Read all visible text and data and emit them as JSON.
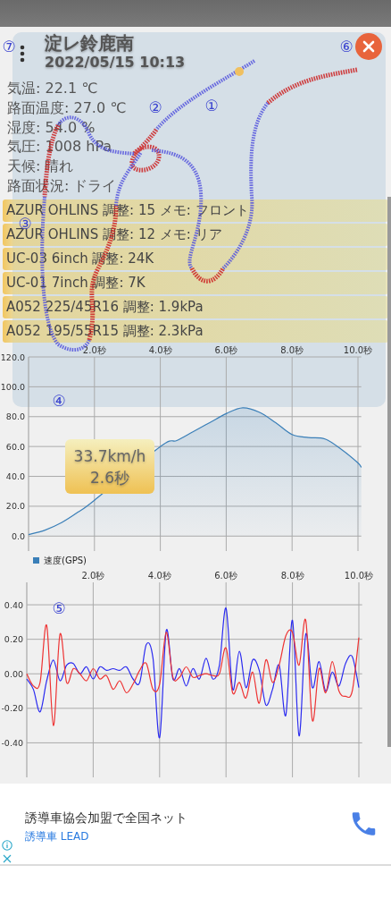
{
  "header": {
    "title": "淀レ鈴鹿南",
    "datetime": "2022/05/15 10:13"
  },
  "conditions": [
    "気温: 22.1 ℃",
    "路面温度: 27.0 ℃",
    "湿度: 54.0 %",
    "気圧: 1008 hPa",
    "天候: 晴れ",
    "路面状況: ドライ"
  ],
  "setups": [
    "AZUR OHLINS 調整: 15 メモ: フロント",
    "AZUR OHLINS 調整: 12 メモ: リア",
    "UC-03 6inch 調整: 24K",
    "UC-01 7inch 調整: 7K",
    "A052 225/45R16 調整: 1.9kPa",
    "A052 195/55R15 調整: 2.3kPa"
  ],
  "speed_chart": {
    "tooltip": {
      "value": "33.7km/h",
      "time": "2.6秒"
    },
    "chart_data": {
      "type": "area",
      "grid": true,
      "x": [
        0,
        0.5,
        1,
        1.5,
        2,
        4,
        4.5,
        5,
        5.5,
        6,
        6.5,
        7,
        7.5,
        8,
        8.5,
        9,
        9.5,
        10,
        10.1
      ],
      "series": [
        {
          "name": "速度(GPS)",
          "color": "#3a7fb8",
          "values": [
            1,
            4,
            9,
            16,
            24,
            60,
            64,
            70,
            76,
            82,
            86,
            83,
            76,
            68,
            66,
            65,
            58,
            49,
            46
          ]
        }
      ],
      "xlim": [
        0,
        10.1
      ],
      "ylim": [
        -10,
        120
      ],
      "xticks": [
        {
          "value": 2,
          "label": "2.0秒"
        },
        {
          "value": 4,
          "label": "4.0秒"
        },
        {
          "value": 6,
          "label": "6.0秒"
        },
        {
          "value": 8,
          "label": "8.0秒"
        },
        {
          "value": 10,
          "label": "10.0秒"
        }
      ],
      "yticks": [
        {
          "value": 0,
          "label": "0.0"
        },
        {
          "value": 20,
          "label": "20.0"
        },
        {
          "value": 40,
          "label": "40.0"
        },
        {
          "value": 60,
          "label": "60.0"
        },
        {
          "value": 80,
          "label": "80.0"
        },
        {
          "value": 100,
          "label": "100.0"
        },
        {
          "value": 120,
          "label": "120.0"
        }
      ]
    }
  },
  "g_chart": {
    "chart_data": {
      "type": "line",
      "grid": true,
      "x": [
        0,
        0.2,
        0.4,
        0.6,
        0.8,
        1,
        1.2,
        1.4,
        1.6,
        1.8,
        2,
        2.2,
        2.4,
        2.6,
        2.8,
        3,
        3.2,
        3.4,
        3.6,
        3.8,
        4,
        4.2,
        4.4,
        4.6,
        4.8,
        5,
        5.2,
        5.4,
        5.6,
        5.8,
        6,
        6.2,
        6.4,
        6.6,
        6.8,
        7,
        7.2,
        7.4,
        7.6,
        7.8,
        8,
        8.2,
        8.4,
        8.6,
        8.8,
        9,
        9.2,
        9.4,
        9.6,
        9.8,
        10
      ],
      "series": [
        {
          "color": "#2a2af0",
          "values": [
            -0.03,
            -0.09,
            -0.22,
            -0.04,
            0.08,
            -0.04,
            0.05,
            0.06,
            0,
            0.04,
            -0.03,
            0.04,
            0.02,
            0.03,
            0.02,
            0.04,
            -0.03,
            -0.05,
            0.17,
            0.09,
            -0.37,
            0.25,
            -0.03,
            0.03,
            -0.07,
            0.03,
            -0.03,
            0.09,
            -0.03,
            0.05,
            0.38,
            -0.09,
            0.13,
            -0.08,
            0.08,
            0.02,
            -0.18,
            -0.09,
            0.05,
            -0.24,
            0.31,
            -0.36,
            0.23,
            -0.08,
            0.07,
            -0.1,
            0.01,
            -0.07,
            0.06,
            0.1,
            -0.08
          ]
        },
        {
          "color": "#ee3333",
          "values": [
            0,
            -0.07,
            -0.05,
            0.28,
            -0.3,
            0.23,
            -0.05,
            0.03,
            0,
            -0.04,
            0.03,
            -0.03,
            -0.01,
            -0.09,
            -0.04,
            -0.11,
            -0.06,
            0.02,
            0.06,
            -0.09,
            -0.06,
            0.24,
            -0.02,
            -0.02,
            0.04,
            -0.02,
            -0.01,
            0,
            -0.01,
            0,
            0.15,
            -0.11,
            -0.05,
            -0.14,
            0.01,
            -0.17,
            0.08,
            -0.05,
            0.05,
            0.22,
            0.24,
            0.05,
            0.31,
            -0.27,
            0.03,
            -0.11,
            0.07,
            -0.1,
            -0.13,
            -0.1,
            0.21
          ]
        }
      ],
      "xlim": [
        0,
        10.1
      ],
      "ylim": [
        -0.6,
        0.53
      ],
      "xticks": [
        {
          "value": 2,
          "label": "2.0秒"
        },
        {
          "value": 4,
          "label": "4.0秒"
        },
        {
          "value": 6,
          "label": "6.0秒"
        },
        {
          "value": 8,
          "label": "8.0秒"
        },
        {
          "value": 10,
          "label": "10.0秒"
        }
      ],
      "yticks": [
        {
          "value": -0.4,
          "label": "-0.40"
        },
        {
          "value": -0.2,
          "label": "-0.20"
        },
        {
          "value": 0,
          "label": "0.00"
        },
        {
          "value": 0.2,
          "label": "0.20"
        },
        {
          "value": 0.4,
          "label": "0.40"
        }
      ]
    }
  },
  "callouts": [
    "①",
    "②",
    "③",
    "④",
    "⑤",
    "⑥",
    "⑦"
  ],
  "ad": {
    "headline": "誘導車協会加盟で全国ネット",
    "advertiser": "誘導車 LEAD"
  }
}
